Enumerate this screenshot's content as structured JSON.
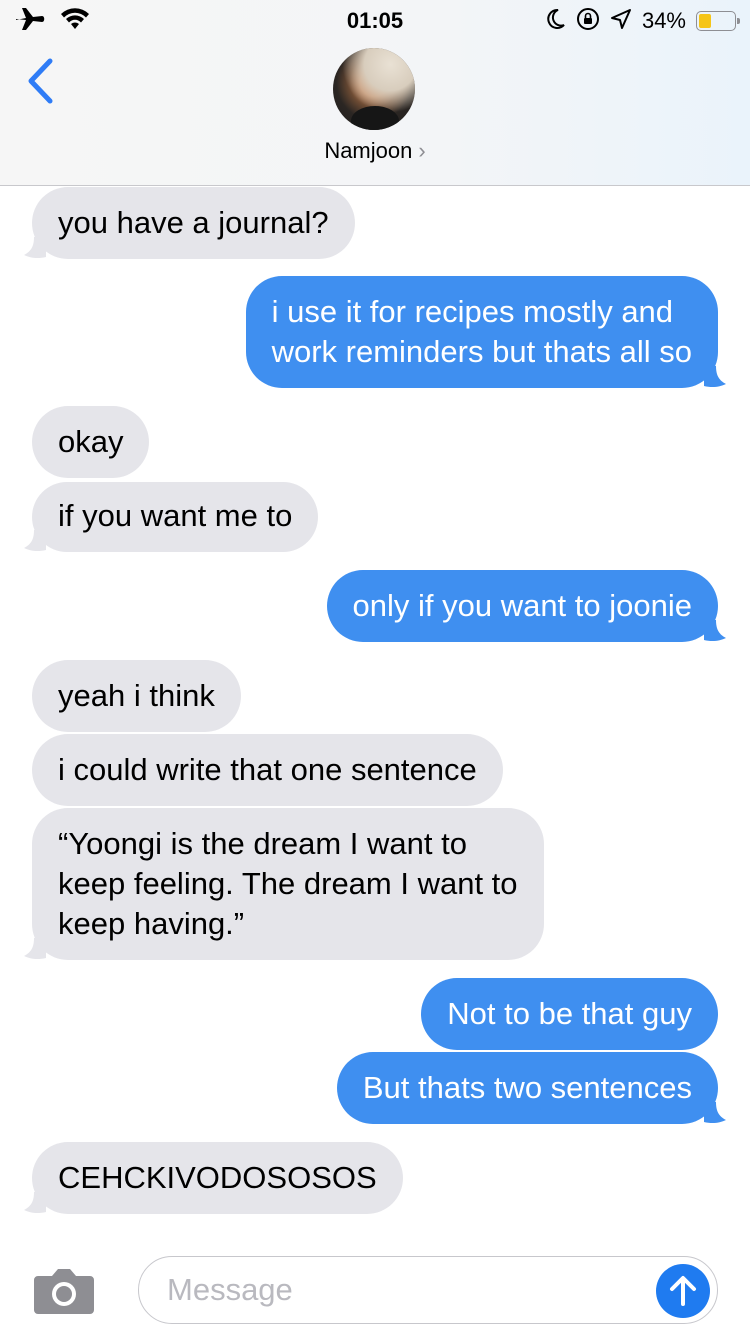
{
  "status_bar": {
    "time": "01:05",
    "battery_percent": "34%",
    "battery_level": 0.34,
    "icons": [
      "airplane-icon",
      "wifi-icon",
      "moon-icon",
      "rotation-lock-icon",
      "location-arrow-icon",
      "battery-icon"
    ]
  },
  "header": {
    "contact_name": "Namjoon",
    "chevron": "›"
  },
  "messages": [
    {
      "direction": "received",
      "text": "you have a journal?"
    },
    {
      "direction": "sent",
      "lines": [
        "i use it for recipes mostly and",
        "work reminders but thats all so"
      ]
    },
    {
      "direction": "received",
      "text": "okay"
    },
    {
      "direction": "received",
      "text": "if you want me to"
    },
    {
      "direction": "sent",
      "text": "only if you want to joonie"
    },
    {
      "direction": "received",
      "text": "yeah i think"
    },
    {
      "direction": "received",
      "text": "i could write that one sentence"
    },
    {
      "direction": "received",
      "lines": [
        "“Yoongi is the dream I want to",
        "keep feeling. The dream I want to",
        "keep having.”"
      ]
    },
    {
      "direction": "sent",
      "text": "Not to be that guy"
    },
    {
      "direction": "sent",
      "text": "But thats two sentences"
    },
    {
      "direction": "received",
      "text": "CEHCKIVODOSOSOS"
    }
  ],
  "composer": {
    "placeholder": "Message"
  },
  "colors": {
    "sent_bubble": "#3f8ff0",
    "received_bubble": "#e5e5ea",
    "accent": "#1f7bf0"
  }
}
